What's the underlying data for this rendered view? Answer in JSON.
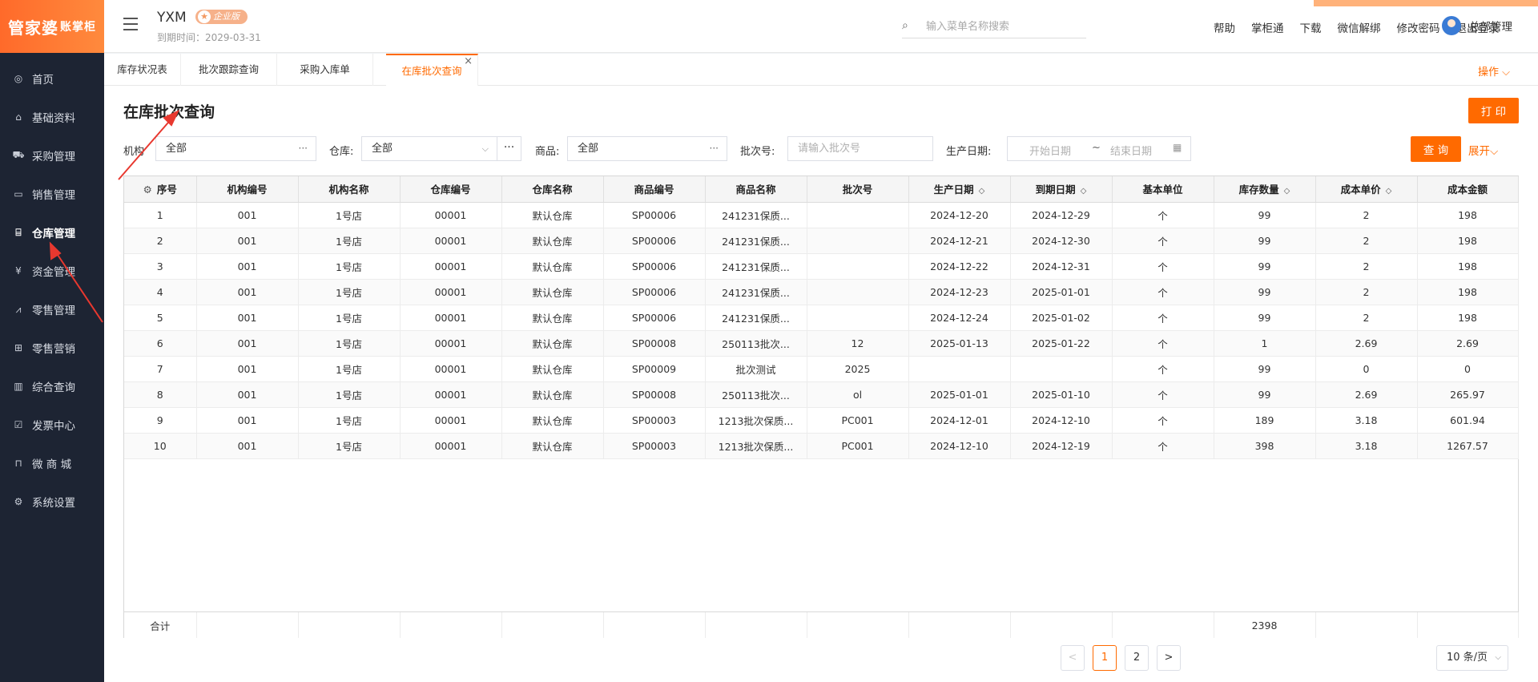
{
  "app": {
    "logo_main": "管家婆",
    "logo_sub": "账掌柜",
    "company": "YXM",
    "edition": "企业版",
    "expire": "到期时间：2029-03-31"
  },
  "search": {
    "placeholder": "输入菜单名称搜索"
  },
  "toplinks": [
    "帮助",
    "掌柜通",
    "下载",
    "微信解绑",
    "修改密码",
    "退出登录"
  ],
  "user": {
    "name": "总部管理"
  },
  "sidebar": {
    "items": [
      {
        "label": "首页",
        "icon": "globe-icon",
        "glyph": "◎"
      },
      {
        "label": "基础资料",
        "icon": "home-icon",
        "glyph": "⌂"
      },
      {
        "label": "采购管理",
        "icon": "cart-icon",
        "glyph": "⛟"
      },
      {
        "label": "销售管理",
        "icon": "card-icon",
        "glyph": "▭"
      },
      {
        "label": "仓库管理",
        "icon": "bank-icon",
        "glyph": "⌸"
      },
      {
        "label": "资金管理",
        "icon": "money-icon",
        "glyph": "¥"
      },
      {
        "label": "零售管理",
        "icon": "chart-line-icon",
        "glyph": "⩘"
      },
      {
        "label": "零售营销",
        "icon": "gift-icon",
        "glyph": "⊞"
      },
      {
        "label": "综合查询",
        "icon": "bar-chart-icon",
        "glyph": "▥"
      },
      {
        "label": "发票中心",
        "icon": "invoice-icon",
        "glyph": "☑"
      },
      {
        "label": "微 商 城",
        "icon": "bag-icon",
        "glyph": "⊓"
      },
      {
        "label": "系统设置",
        "icon": "gear-icon",
        "glyph": "⚙"
      }
    ],
    "active_index": 4
  },
  "tabs": [
    {
      "label": "库存状况表"
    },
    {
      "label": "批次跟踪查询"
    },
    {
      "label": "采购入库单"
    },
    {
      "label": "在库批次查询"
    }
  ],
  "ops_label": "操作",
  "page": {
    "title": "在库批次查询",
    "print_label": "打 印",
    "query_label": "查 询",
    "expand_label": "展开"
  },
  "filters": {
    "org_label": "机构",
    "org_value": "全部",
    "warehouse_label": "仓库:",
    "warehouse_value": "全部",
    "product_label": "商品:",
    "product_value": "全部",
    "batch_label": "批次号:",
    "batch_placeholder": "请输入批次号",
    "date_label": "生产日期:",
    "date_start": "开始日期",
    "date_sep": "~",
    "date_end": "结束日期"
  },
  "table": {
    "columns": [
      "序号",
      "机构编号",
      "机构名称",
      "仓库编号",
      "仓库名称",
      "商品编号",
      "商品名称",
      "批次号",
      "生产日期",
      "到期日期",
      "基本单位",
      "库存数量",
      "成本单价",
      "成本金额"
    ],
    "sortable": [
      false,
      false,
      false,
      false,
      false,
      false,
      false,
      false,
      true,
      true,
      false,
      true,
      true,
      false
    ],
    "rows": [
      [
        "1",
        "001",
        "1号店",
        "00001",
        "默认仓库",
        "SP00006",
        "241231保质...",
        "",
        "2024-12-20",
        "2024-12-29",
        "个",
        "99",
        "2",
        "198"
      ],
      [
        "2",
        "001",
        "1号店",
        "00001",
        "默认仓库",
        "SP00006",
        "241231保质...",
        "",
        "2024-12-21",
        "2024-12-30",
        "个",
        "99",
        "2",
        "198"
      ],
      [
        "3",
        "001",
        "1号店",
        "00001",
        "默认仓库",
        "SP00006",
        "241231保质...",
        "",
        "2024-12-22",
        "2024-12-31",
        "个",
        "99",
        "2",
        "198"
      ],
      [
        "4",
        "001",
        "1号店",
        "00001",
        "默认仓库",
        "SP00006",
        "241231保质...",
        "",
        "2024-12-23",
        "2025-01-01",
        "个",
        "99",
        "2",
        "198"
      ],
      [
        "5",
        "001",
        "1号店",
        "00001",
        "默认仓库",
        "SP00006",
        "241231保质...",
        "",
        "2024-12-24",
        "2025-01-02",
        "个",
        "99",
        "2",
        "198"
      ],
      [
        "6",
        "001",
        "1号店",
        "00001",
        "默认仓库",
        "SP00008",
        "250113批次...",
        "12",
        "2025-01-13",
        "2025-01-22",
        "个",
        "1",
        "2.69",
        "2.69"
      ],
      [
        "7",
        "001",
        "1号店",
        "00001",
        "默认仓库",
        "SP00009",
        "批次测试",
        "2025",
        "",
        "",
        "个",
        "99",
        "0",
        "0"
      ],
      [
        "8",
        "001",
        "1号店",
        "00001",
        "默认仓库",
        "SP00008",
        "250113批次...",
        "ol",
        "2025-01-01",
        "2025-01-10",
        "个",
        "99",
        "2.69",
        "265.97"
      ],
      [
        "9",
        "001",
        "1号店",
        "00001",
        "默认仓库",
        "SP00003",
        "1213批次保质...",
        "PC001",
        "2024-12-01",
        "2024-12-10",
        "个",
        "189",
        "3.18",
        "601.94"
      ],
      [
        "10",
        "001",
        "1号店",
        "00001",
        "默认仓库",
        "SP00003",
        "1213批次保质...",
        "PC001",
        "2024-12-10",
        "2024-12-19",
        "个",
        "398",
        "3.18",
        "1267.57"
      ]
    ],
    "footer": {
      "label": "合计",
      "qty_total": "2398"
    }
  },
  "pagination": {
    "prev": "<",
    "pages": [
      "1",
      "2"
    ],
    "current": "1",
    "next": ">",
    "page_size": "10 条/页"
  },
  "colors": {
    "accent": "#ff6a00",
    "sidebar_bg": "#1d2433",
    "annotation": "#e8382f"
  }
}
